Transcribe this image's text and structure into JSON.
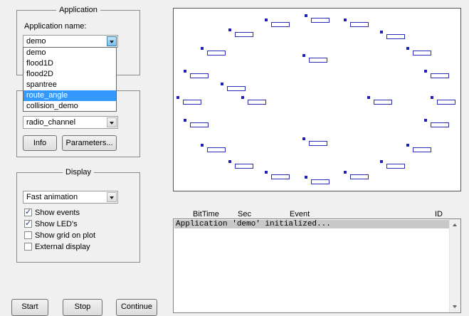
{
  "application_group": {
    "title": "Application",
    "name_label": "Application name:",
    "selected": "demo",
    "options": [
      "demo",
      "flood1D",
      "flood2D",
      "spantree",
      "route_angle",
      "collision_demo"
    ],
    "highlighted_option": "route_angle"
  },
  "radio_group": {
    "channel_selected": "radio_channel",
    "info_label": "Info",
    "parameters_label": "Parameters..."
  },
  "display_group": {
    "title": "Display",
    "mode_selected": "Fast animation",
    "checkboxes": [
      {
        "label": "Show events",
        "checked": true
      },
      {
        "label": "Show LED's",
        "checked": true
      },
      {
        "label": "Show grid on plot",
        "checked": false
      },
      {
        "label": "External display",
        "checked": false
      }
    ]
  },
  "controls": {
    "start": "Start",
    "stop": "Stop",
    "continue": "Continue"
  },
  "log": {
    "columns": [
      "BitTime",
      "Sec",
      "Event",
      "ID"
    ],
    "lines": [
      "Application 'demo' initialized..."
    ]
  },
  "plot": {
    "node_count": 26,
    "colors": {
      "node": "#1f1fb8",
      "border": "#555555"
    }
  }
}
